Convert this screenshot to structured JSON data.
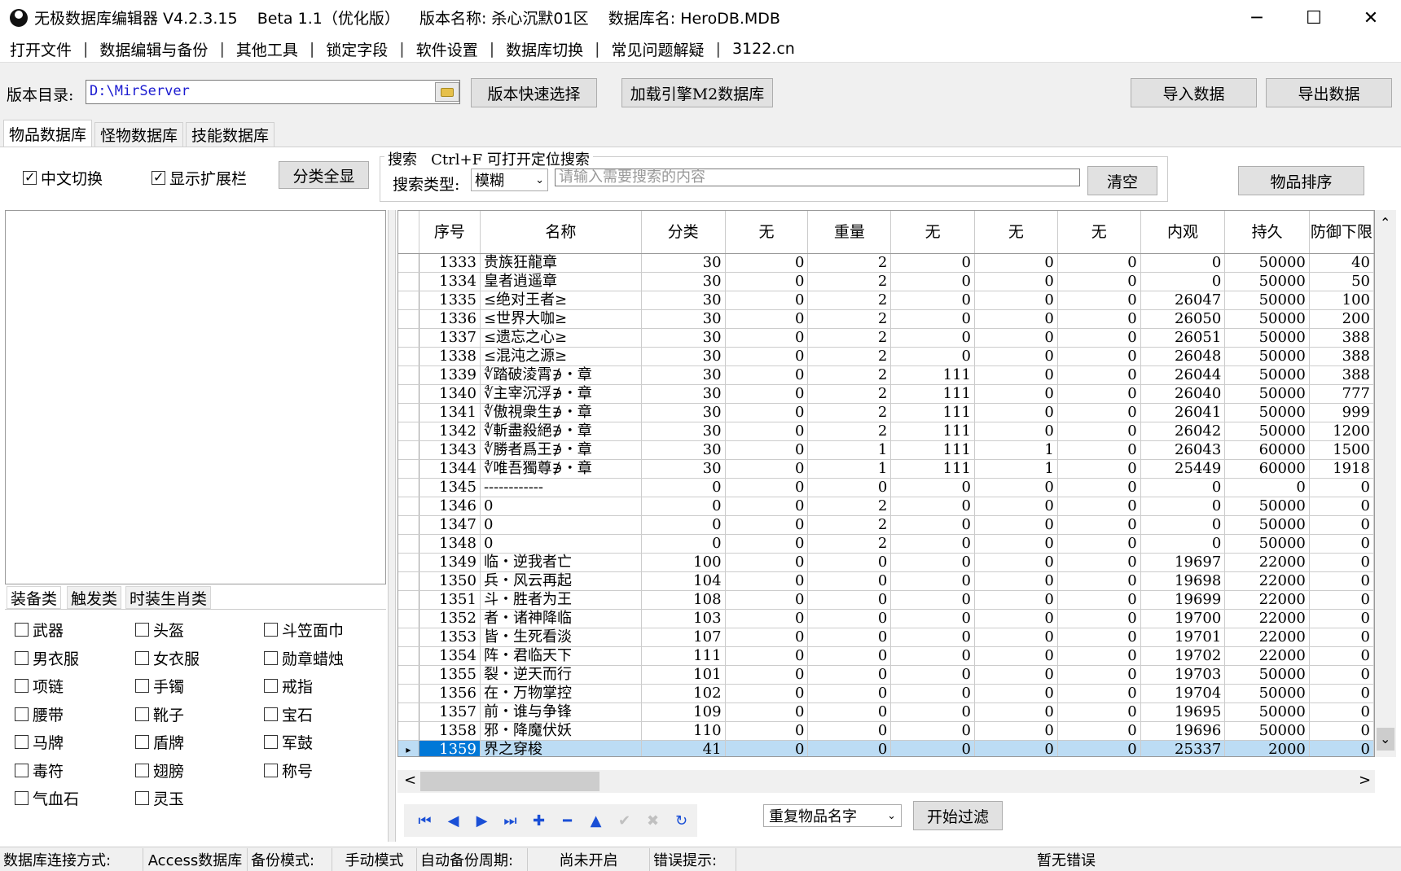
{
  "window": {
    "title": "无极数据库编辑器 V4.2.3.15    Beta 1.1（优化版）    版本名称: 杀心沉默01区    数据库名: HeroDB.MDB",
    "minimize": "─",
    "maximize": "☐",
    "close": "✕"
  },
  "menu": {
    "items": [
      "打开文件",
      "数据编辑与备份",
      "其他工具",
      "锁定字段",
      "软件设置",
      "数据库切换",
      "常见问题解疑",
      "3122.cn"
    ],
    "separator": "|"
  },
  "toolbar": {
    "dir_label": "版本目录:",
    "dir_value": "D:\\MirServer",
    "quick_select": "版本快速选择",
    "load_m2": "加载引擎M2数据库",
    "import": "导入数据",
    "export": "导出数据"
  },
  "tabs": [
    "物品数据库",
    "怪物数据库",
    "技能数据库"
  ],
  "filters": {
    "chinese_switch": "中文切换",
    "show_ext": "显示扩展栏",
    "show_all": "分类全显",
    "search_legend": "搜索   Ctrl+F 可打开定位搜索",
    "search_type_label": "搜索类型:",
    "search_type_value": "模糊",
    "search_placeholder": "请输入需要搜索的内容",
    "clear": "清空",
    "sort": "物品排序"
  },
  "subtabs": [
    "装备类",
    "触发类",
    "时装生肖类"
  ],
  "categories": [
    [
      "武器",
      "头盔",
      "斗笠面巾"
    ],
    [
      "男衣服",
      "女衣服",
      "勋章蜡烛"
    ],
    [
      "项链",
      "手镯",
      "戒指"
    ],
    [
      "腰带",
      "靴子",
      "宝石"
    ],
    [
      "马牌",
      "盾牌",
      "军鼓"
    ],
    [
      "毒符",
      "翅膀",
      "称号"
    ],
    [
      "气血石",
      "灵玉",
      ""
    ]
  ],
  "grid": {
    "headers": [
      "序号",
      "名称",
      "分类",
      "无",
      "重量",
      "无",
      "无",
      "无",
      "内观",
      "持久",
      "防御下限"
    ],
    "rows": [
      [
        "1333",
        "贵族狂龍章",
        "30",
        "0",
        "2",
        "0",
        "0",
        "0",
        "0",
        "50000",
        "40"
      ],
      [
        "1334",
        "皇者逍遥章",
        "30",
        "0",
        "2",
        "0",
        "0",
        "0",
        "0",
        "50000",
        "50"
      ],
      [
        "1335",
        "≤绝对王者≥",
        "30",
        "0",
        "2",
        "0",
        "0",
        "0",
        "26047",
        "50000",
        "100"
      ],
      [
        "1336",
        "≤世界大咖≥",
        "30",
        "0",
        "2",
        "0",
        "0",
        "0",
        "26050",
        "50000",
        "200"
      ],
      [
        "1337",
        "≤遗忘之心≥",
        "30",
        "0",
        "2",
        "0",
        "0",
        "0",
        "26051",
        "50000",
        "388"
      ],
      [
        "1338",
        "≤混沌之源≥",
        "30",
        "0",
        "2",
        "0",
        "0",
        "0",
        "26048",
        "50000",
        "388"
      ],
      [
        "1339",
        "∜踏破淩霄∌・章",
        "30",
        "0",
        "2",
        "111",
        "0",
        "0",
        "26044",
        "50000",
        "388"
      ],
      [
        "1340",
        "∜主宰沉浮∌・章",
        "30",
        "0",
        "2",
        "111",
        "0",
        "0",
        "26040",
        "50000",
        "777"
      ],
      [
        "1341",
        "∜傲視衆生∌・章",
        "30",
        "0",
        "2",
        "111",
        "0",
        "0",
        "26041",
        "50000",
        "999"
      ],
      [
        "1342",
        "∜斬盡殺絕∌・章",
        "30",
        "0",
        "2",
        "111",
        "0",
        "0",
        "26042",
        "50000",
        "1200"
      ],
      [
        "1343",
        "∜勝者爲王∌・章",
        "30",
        "0",
        "1",
        "111",
        "1",
        "0",
        "26043",
        "60000",
        "1500"
      ],
      [
        "1344",
        "∜唯吾獨尊∌・章",
        "30",
        "0",
        "1",
        "111",
        "1",
        "0",
        "25449",
        "60000",
        "1918"
      ],
      [
        "1345",
        "------------",
        "0",
        "0",
        "0",
        "0",
        "0",
        "0",
        "0",
        "0",
        "0"
      ],
      [
        "1346",
        "0",
        "0",
        "0",
        "2",
        "0",
        "0",
        "0",
        "0",
        "50000",
        "0"
      ],
      [
        "1347",
        "0",
        "0",
        "0",
        "2",
        "0",
        "0",
        "0",
        "0",
        "50000",
        "0"
      ],
      [
        "1348",
        "0",
        "0",
        "0",
        "2",
        "0",
        "0",
        "0",
        "0",
        "50000",
        "0"
      ],
      [
        "1349",
        "临・逆我者亡",
        "100",
        "0",
        "0",
        "0",
        "0",
        "0",
        "19697",
        "22000",
        "0"
      ],
      [
        "1350",
        "兵・风云再起",
        "104",
        "0",
        "0",
        "0",
        "0",
        "0",
        "19698",
        "22000",
        "0"
      ],
      [
        "1351",
        "斗・胜者为王",
        "108",
        "0",
        "0",
        "0",
        "0",
        "0",
        "19699",
        "22000",
        "0"
      ],
      [
        "1352",
        "者・诸神降临",
        "103",
        "0",
        "0",
        "0",
        "0",
        "0",
        "19700",
        "22000",
        "0"
      ],
      [
        "1353",
        "皆・生死看淡",
        "107",
        "0",
        "0",
        "0",
        "0",
        "0",
        "19701",
        "22000",
        "0"
      ],
      [
        "1354",
        "阵・君临天下",
        "111",
        "0",
        "0",
        "0",
        "0",
        "0",
        "19702",
        "22000",
        "0"
      ],
      [
        "1355",
        "裂・逆天而行",
        "101",
        "0",
        "0",
        "0",
        "0",
        "0",
        "19703",
        "50000",
        "0"
      ],
      [
        "1356",
        "在・万物掌控",
        "102",
        "0",
        "0",
        "0",
        "0",
        "0",
        "19704",
        "50000",
        "0"
      ],
      [
        "1357",
        "前・谁与争锋",
        "109",
        "0",
        "0",
        "0",
        "0",
        "0",
        "19695",
        "50000",
        "0"
      ],
      [
        "1358",
        "邪・降魔伏妖",
        "110",
        "0",
        "0",
        "0",
        "0",
        "0",
        "19696",
        "50000",
        "0"
      ],
      [
        "1359",
        "界之穿梭",
        "41",
        "0",
        "0",
        "0",
        "0",
        "0",
        "25337",
        "2000",
        "0"
      ]
    ],
    "selected_index": 26,
    "row_marker": "▸"
  },
  "nav": {
    "icons": [
      "first-icon",
      "prior-icon",
      "next-icon",
      "last-icon",
      "insert-icon",
      "delete-icon",
      "edit-icon",
      "post-icon",
      "cancel-icon",
      "refresh-icon"
    ],
    "glyphs": [
      "⏮",
      "◀",
      "▶",
      "⏭",
      "✚",
      "━",
      "▲",
      "✔",
      "✖",
      "↻"
    ]
  },
  "filter_bar": {
    "dup_select": "重复物品名字",
    "start_filter": "开始过滤"
  },
  "scroll": {
    "left": "<",
    "right": ">",
    "up": "⌃",
    "down": "⌄"
  },
  "status": {
    "conn_label": "数据库连接方式:",
    "conn_value": "Access数据库",
    "backup_label": "备份模式:",
    "backup_value": "手动模式",
    "auto_label": "自动备份周期:",
    "auto_value": "尚未开启",
    "error_label": "错误提示:",
    "error_value": "暂无错误"
  }
}
